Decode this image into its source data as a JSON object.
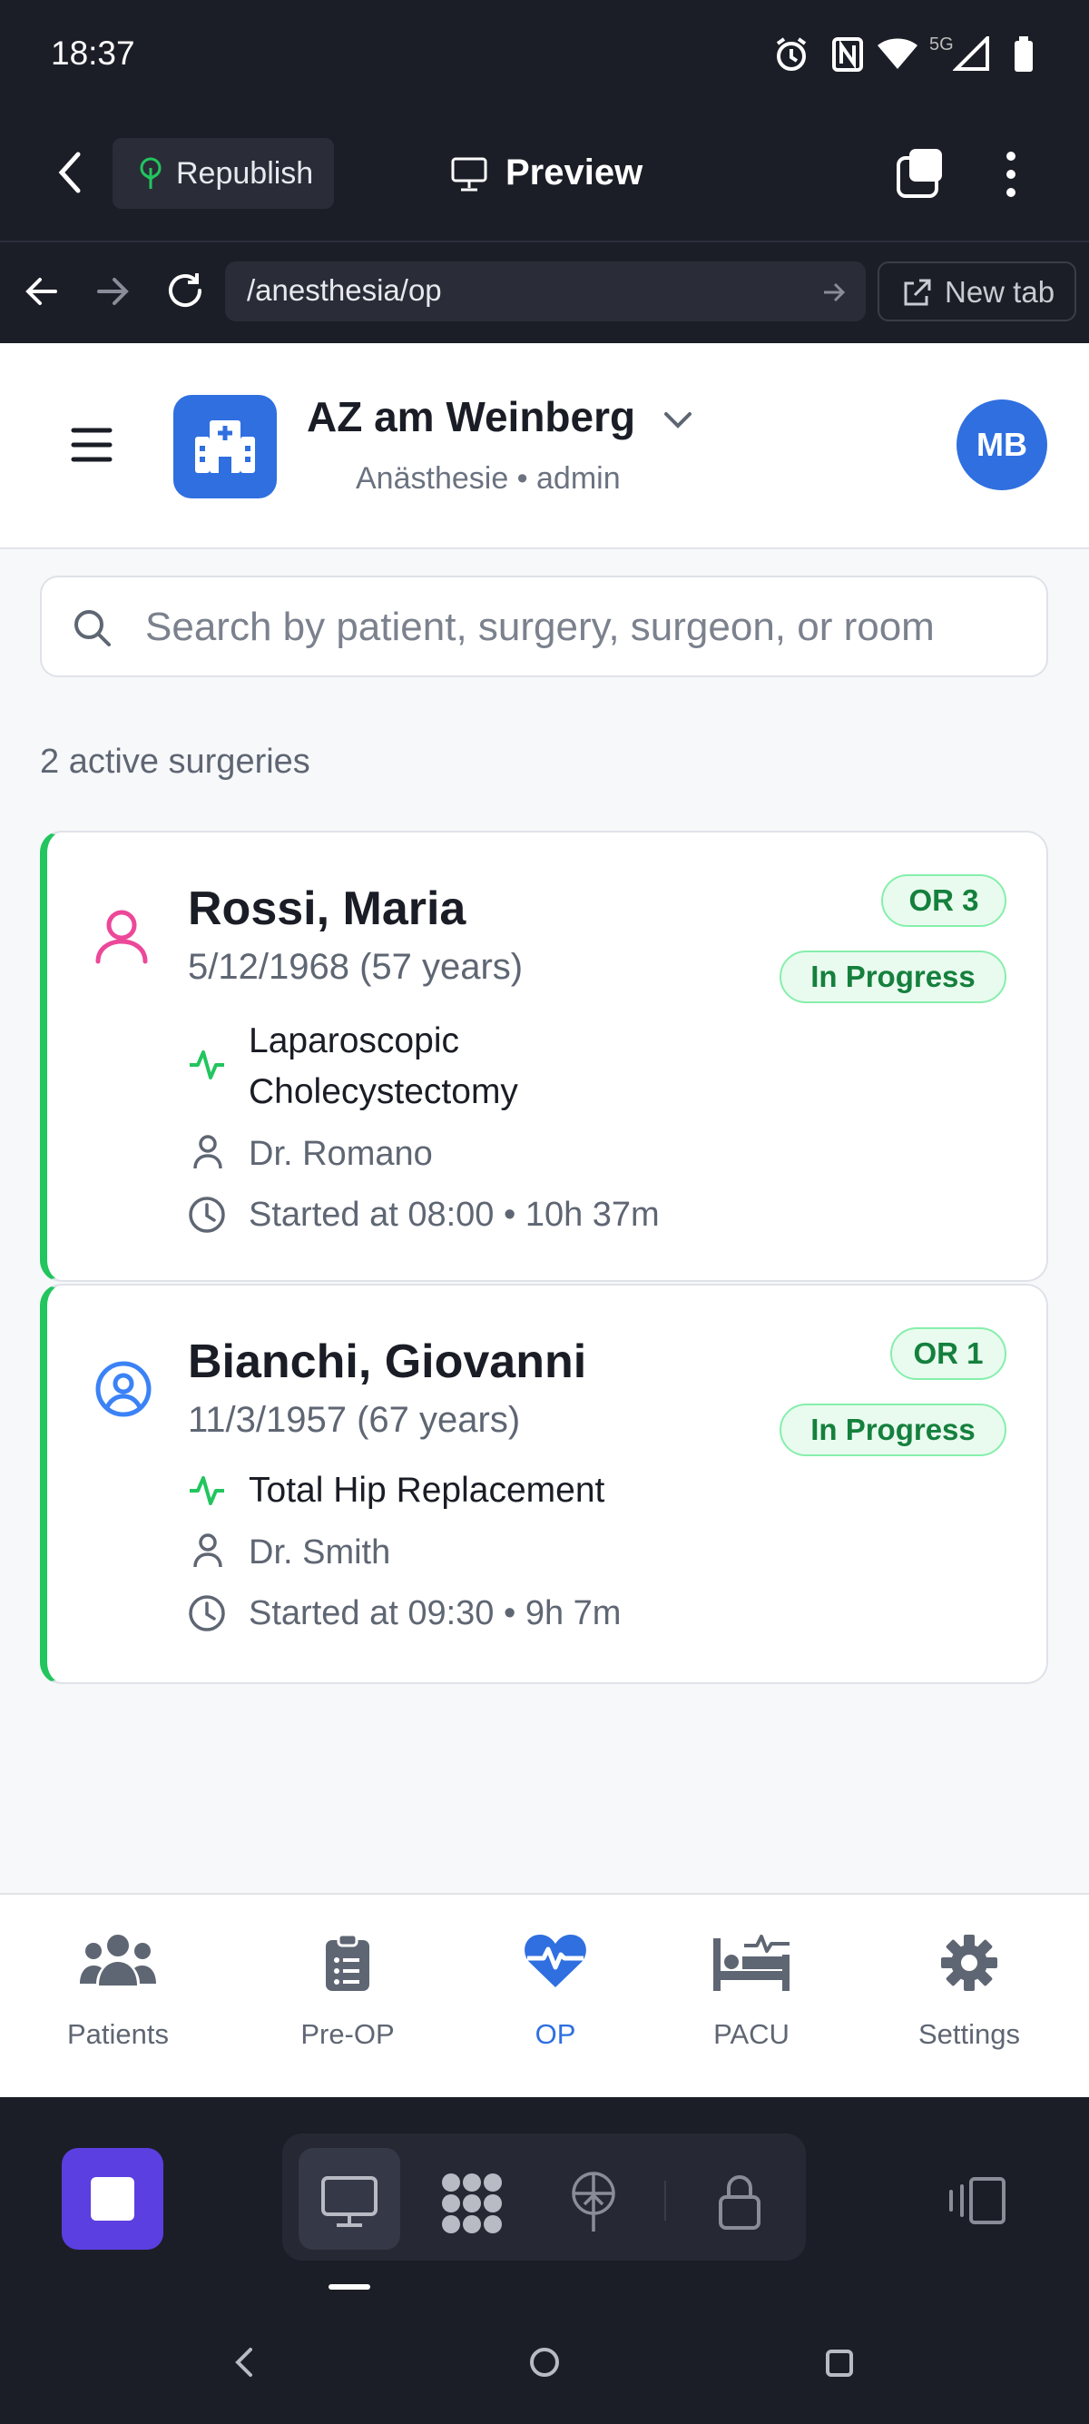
{
  "status_bar": {
    "time": "18:37",
    "network": "5G"
  },
  "browser": {
    "republish_label": "Republish",
    "preview_label": "Preview",
    "url": "/anesthesia/op",
    "new_tab_label": "New tab"
  },
  "header": {
    "hospital_name": "AZ am Weinberg",
    "subtitle": "Anästhesie • admin",
    "avatar_initials": "MB"
  },
  "search": {
    "placeholder": "Search by patient, surgery, surgeon, or room"
  },
  "summary": {
    "active_count_text": "2 active surgeries"
  },
  "surgeries": [
    {
      "name": "Rossi, Maria",
      "dob": "5/12/1968 (57 years)",
      "room": "OR 3",
      "status": "In Progress",
      "procedure_line1": "Laparoscopic",
      "procedure_line2": "Cholecystectomy",
      "surgeon": "Dr. Romano",
      "started": "Started at 08:00 • 10h 37m",
      "avatar_color": "#ec4899"
    },
    {
      "name": "Bianchi, Giovanni",
      "dob": "11/3/1957 (67 years)",
      "room": "OR 1",
      "status": "In Progress",
      "procedure": "Total Hip Replacement",
      "surgeon": "Dr. Smith",
      "started": "Started at 09:30 • 9h 7m",
      "avatar_color": "#3b82f6"
    }
  ],
  "bottom_nav": [
    {
      "label": "Patients",
      "icon": "users-icon"
    },
    {
      "label": "Pre-OP",
      "icon": "clipboard-icon"
    },
    {
      "label": "OP",
      "icon": "heartbeat-icon",
      "active": true
    },
    {
      "label": "PACU",
      "icon": "bed-icon"
    },
    {
      "label": "Settings",
      "icon": "gear-icon"
    }
  ],
  "colors": {
    "accent": "#2f6fe0",
    "success": "#22c55e",
    "dark": "#1c1e27"
  }
}
